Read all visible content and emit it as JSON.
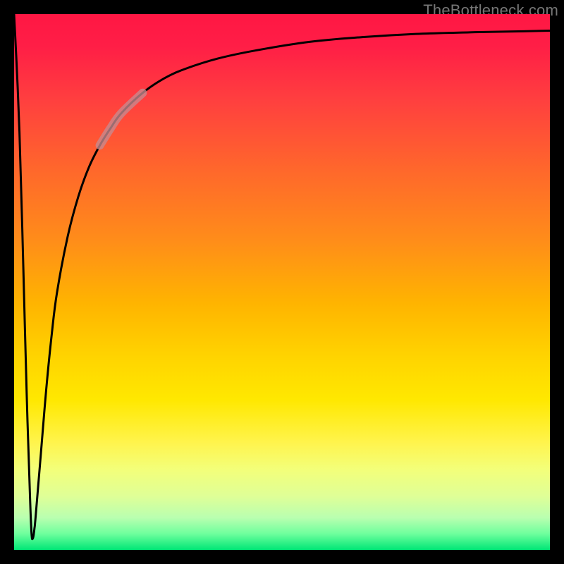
{
  "watermark": "TheBottleneck.com",
  "colors": {
    "frame": "#000000",
    "curve_main": "#000000",
    "curve_highlight": "#c78a8f"
  },
  "chart_data": {
    "type": "line",
    "title": "",
    "xlabel": "",
    "ylabel": "",
    "xlim": [
      0,
      100
    ],
    "ylim": [
      0,
      100
    ],
    "grid": false,
    "legend": false,
    "annotations": [
      "TheBottleneck.com"
    ],
    "series": [
      {
        "name": "bottleneck-curve-left-descent",
        "x": [
          0.0,
          0.5,
          1.0,
          1.5,
          2.0,
          2.5,
          3.0,
          3.2,
          3.3
        ],
        "y": [
          100.0,
          90.0,
          78.0,
          61.0,
          42.0,
          24.0,
          9.0,
          4.0,
          2.5
        ]
      },
      {
        "name": "bottleneck-curve-valley",
        "x": [
          3.3,
          3.4,
          3.6,
          3.8,
          4.0
        ],
        "y": [
          2.5,
          2.0,
          2.5,
          4.0,
          6.0
        ]
      },
      {
        "name": "bottleneck-curve-right-rise",
        "x": [
          4.0,
          5.0,
          6.0,
          7.0,
          8.0,
          10.0,
          12.0,
          14.0,
          16.0,
          18.0,
          20.0,
          24.0,
          28.0,
          32.0,
          38.0,
          45.0,
          55.0,
          65.0,
          75.0,
          85.0,
          95.0,
          100.0
        ],
        "y": [
          6.0,
          18.0,
          30.0,
          40.0,
          48.0,
          58.5,
          66.0,
          71.5,
          75.5,
          78.7,
          81.5,
          85.3,
          88.0,
          89.8,
          91.7,
          93.2,
          94.8,
          95.7,
          96.3,
          96.6,
          96.8,
          96.9
        ]
      }
    ],
    "highlight_segment": {
      "series": "bottleneck-curve-right-rise",
      "x_range": [
        16.0,
        24.0
      ],
      "note": "thickened pale segment on the rising branch"
    }
  }
}
